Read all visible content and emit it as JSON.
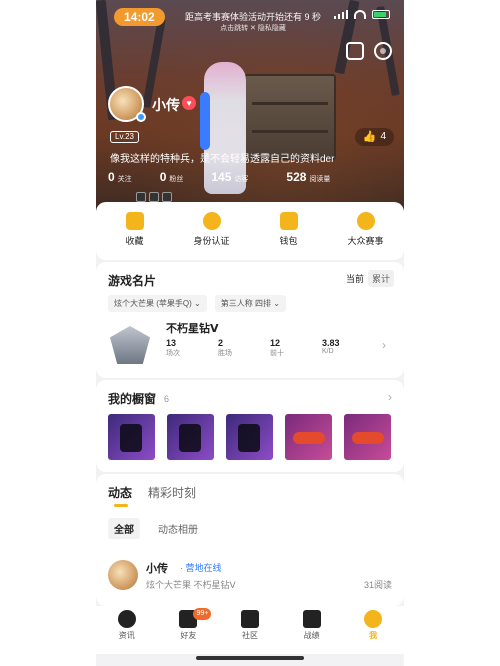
{
  "status_bar": {
    "time": "14:02"
  },
  "hero": {
    "notice_title": "距高考事赛体验活动开始还有 9 秒",
    "notice_sub": "点击跳转 ✕ 隐私隐藏",
    "username": "小传",
    "level": "Lv.23",
    "like_count": "4",
    "bio": "像我这样的特种兵，是不会轻易透露自己的资料der",
    "stats": [
      {
        "n": "0",
        "l": "关注"
      },
      {
        "n": "0",
        "l": "粉丝"
      },
      {
        "n": "145",
        "l": "访客"
      },
      {
        "n": "528",
        "l": "阅读量"
      }
    ]
  },
  "quick_actions": [
    {
      "label": "收藏"
    },
    {
      "label": "身份认证"
    },
    {
      "label": "钱包"
    },
    {
      "label": "大众赛事"
    }
  ],
  "game_card": {
    "title": "游戏名片",
    "toggle": [
      "当前",
      "累计"
    ],
    "filters": [
      "炫个大芒果 (苹果手Q)",
      "第三人称 四排"
    ],
    "rank": {
      "name": "不朽星钻Ⅴ",
      "stats": [
        {
          "n": "13",
          "l": "场次"
        },
        {
          "n": "2",
          "l": "胜场"
        },
        {
          "n": "12",
          "l": "前十"
        },
        {
          "n": "3.83",
          "l": "K/D"
        }
      ]
    }
  },
  "showcase": {
    "title": "我的橱窗",
    "count": "6"
  },
  "feed": {
    "tabs": [
      "动态",
      "精彩时刻"
    ],
    "subtabs": [
      "全部",
      "动态相册"
    ],
    "post": {
      "name": "小传",
      "status": "· 营地在线",
      "subtitle": "炫个大芒果   不朽星钻Ⅴ",
      "reads": "31阅读"
    }
  },
  "bottom_nav": [
    {
      "label": "资讯"
    },
    {
      "label": "好友",
      "badge": "99+"
    },
    {
      "label": "社区"
    },
    {
      "label": "战绩"
    },
    {
      "label": "我"
    }
  ]
}
